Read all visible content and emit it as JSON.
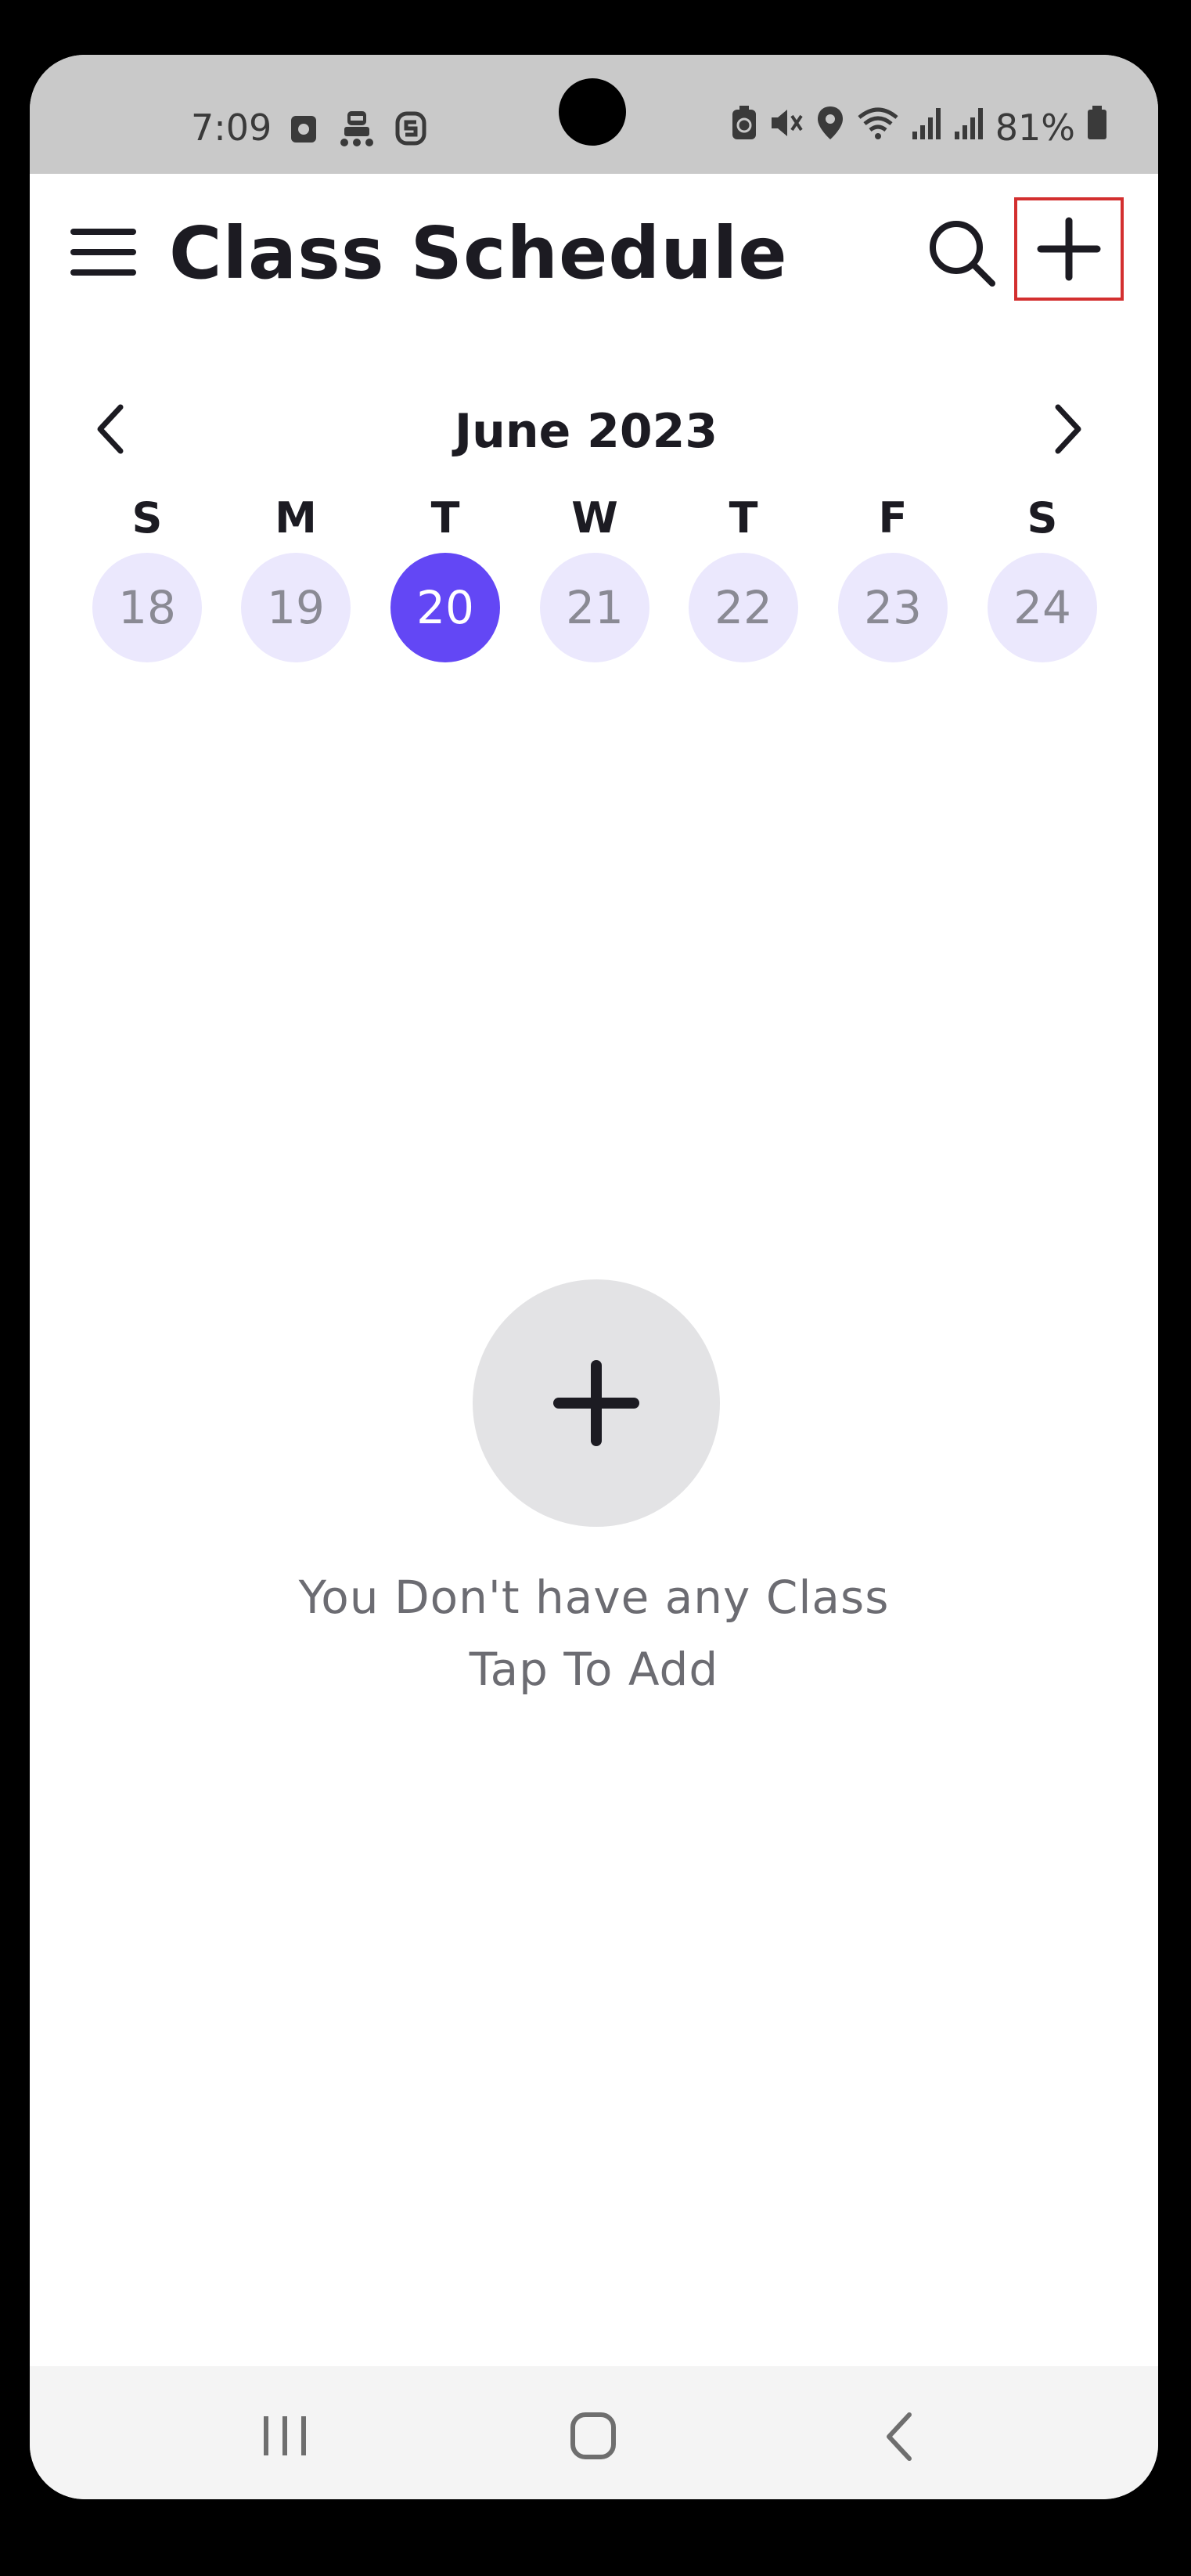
{
  "status_bar": {
    "time": "7:09",
    "battery_percent": "81%",
    "left_icons": [
      "screenshot-icon",
      "robot-icon",
      "s-icon"
    ],
    "right_icons": [
      "battery-saver-icon",
      "mute-icon",
      "location-icon",
      "wifi-icon",
      "signal-icon",
      "signal-icon",
      "battery-icon"
    ]
  },
  "app_bar": {
    "title": "Class Schedule",
    "menu_icon": "hamburger-menu-icon",
    "search_icon": "search-icon",
    "add_icon": "plus-icon",
    "highlight_color": "#d32f2f"
  },
  "calendar": {
    "month_label": "June 2023",
    "weekdays": [
      "S",
      "M",
      "T",
      "W",
      "T",
      "F",
      "S"
    ],
    "dates": [
      "18",
      "19",
      "20",
      "21",
      "22",
      "23",
      "24"
    ],
    "selected_date": "20",
    "accent_color": "#6347f5",
    "date_bg_color": "#ebe8fd"
  },
  "empty_state": {
    "line1": "You Don't have any Class",
    "line2": "Tap To Add",
    "icon": "plus-icon"
  },
  "nav_bar": {
    "icons": [
      "recent-apps-icon",
      "home-icon",
      "back-icon"
    ]
  }
}
